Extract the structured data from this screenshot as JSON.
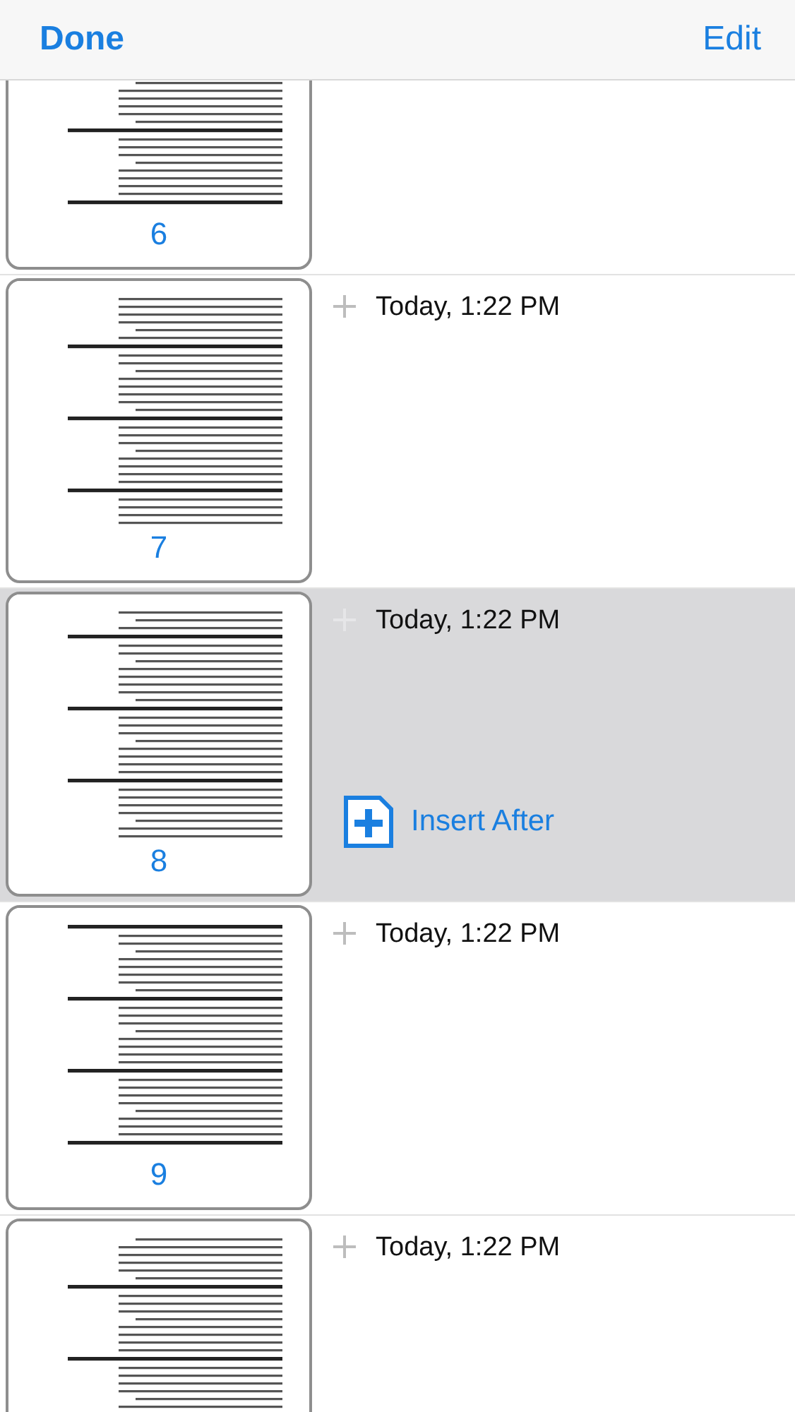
{
  "nav_bar": {
    "left_button": "Done",
    "right_button": "Edit"
  },
  "pages": [
    {
      "number": "6",
      "selected": false
    },
    {
      "number": "7",
      "date": "Today, 1:22 PM",
      "selected": false
    },
    {
      "number": "8",
      "date": "Today, 1:22 PM",
      "selected": true,
      "action": "Insert After"
    },
    {
      "number": "9",
      "date": "Today, 1:22 PM",
      "selected": false
    },
    {
      "date": "Today, 1:22 PM",
      "selected": false
    }
  ]
}
